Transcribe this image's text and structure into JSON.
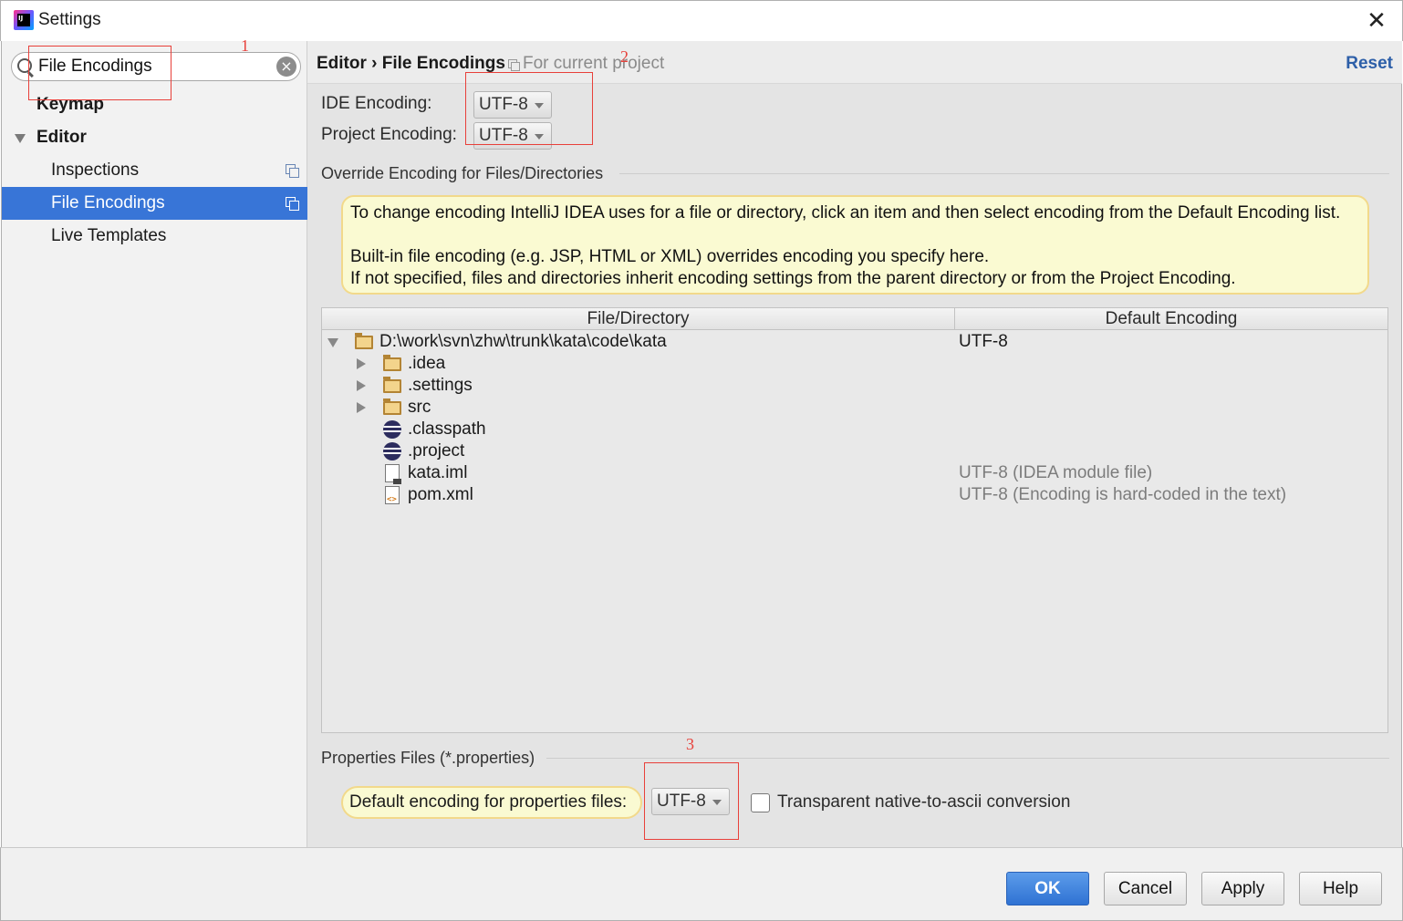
{
  "window": {
    "title": "Settings",
    "close": "✕"
  },
  "sidebar": {
    "search": {
      "value": "File Encodings"
    },
    "items": [
      {
        "label": "Keymap"
      },
      {
        "label": "Editor"
      },
      {
        "label": "Inspections"
      },
      {
        "label": "File Encodings",
        "selected": true
      },
      {
        "label": "Live Templates"
      }
    ]
  },
  "main": {
    "breadcrumb": "Editor › File Encodings",
    "scope_note": "For current project",
    "reset": "Reset",
    "ide_encoding": {
      "label": "IDE Encoding:",
      "value": "UTF-8"
    },
    "project_encoding": {
      "label": "Project Encoding:",
      "value": "UTF-8"
    },
    "override_section": "Override Encoding for Files/Directories",
    "info": {
      "line1": "To change encoding IntelliJ IDEA uses for a file or directory, click an item and then select encoding from the Default Encoding list.",
      "line2": "Built-in file encoding (e.g. JSP, HTML or XML) overrides encoding you specify here.",
      "line3": "If not specified, files and directories inherit encoding settings from the parent directory or from the Project Encoding."
    },
    "table": {
      "headers": [
        "File/Directory",
        "Default Encoding"
      ],
      "rows": [
        {
          "name": "D:\\work\\svn\\zhw\\trunk\\kata\\code\\kata",
          "encoding": "UTF-8",
          "icon": "folder-icon"
        },
        {
          "name": ".idea",
          "encoding": "",
          "icon": "folder-icon"
        },
        {
          "name": ".settings",
          "encoding": "",
          "icon": "folder-icon"
        },
        {
          "name": "src",
          "encoding": "",
          "icon": "folder-icon"
        },
        {
          "name": ".classpath",
          "encoding": "",
          "icon": "eclipse-icon"
        },
        {
          "name": ".project",
          "encoding": "",
          "icon": "eclipse-icon"
        },
        {
          "name": "kata.iml",
          "encoding": "UTF-8 (IDEA module file)",
          "icon": "iml-file-icon"
        },
        {
          "name": "pom.xml",
          "encoding": "UTF-8 (Encoding is hard-coded in the text)",
          "icon": "xml-file-icon"
        }
      ]
    },
    "properties_section": "Properties Files (*.properties)",
    "properties_default": {
      "label": "Default encoding for properties files:",
      "value": "UTF-8"
    },
    "transparent_conversion": {
      "label": "Transparent native-to-ascii conversion",
      "checked": false
    }
  },
  "footer": {
    "ok": "OK",
    "cancel": "Cancel",
    "apply": "Apply",
    "help": "Help"
  },
  "annotations": {
    "n1": "1",
    "n2": "2",
    "n3": "3",
    "color": "#e8403a"
  },
  "colors": {
    "selection": "#3875d7",
    "primary_button": "#2f72d3",
    "link": "#2d5fa8",
    "info_bg": "#fafad2"
  }
}
